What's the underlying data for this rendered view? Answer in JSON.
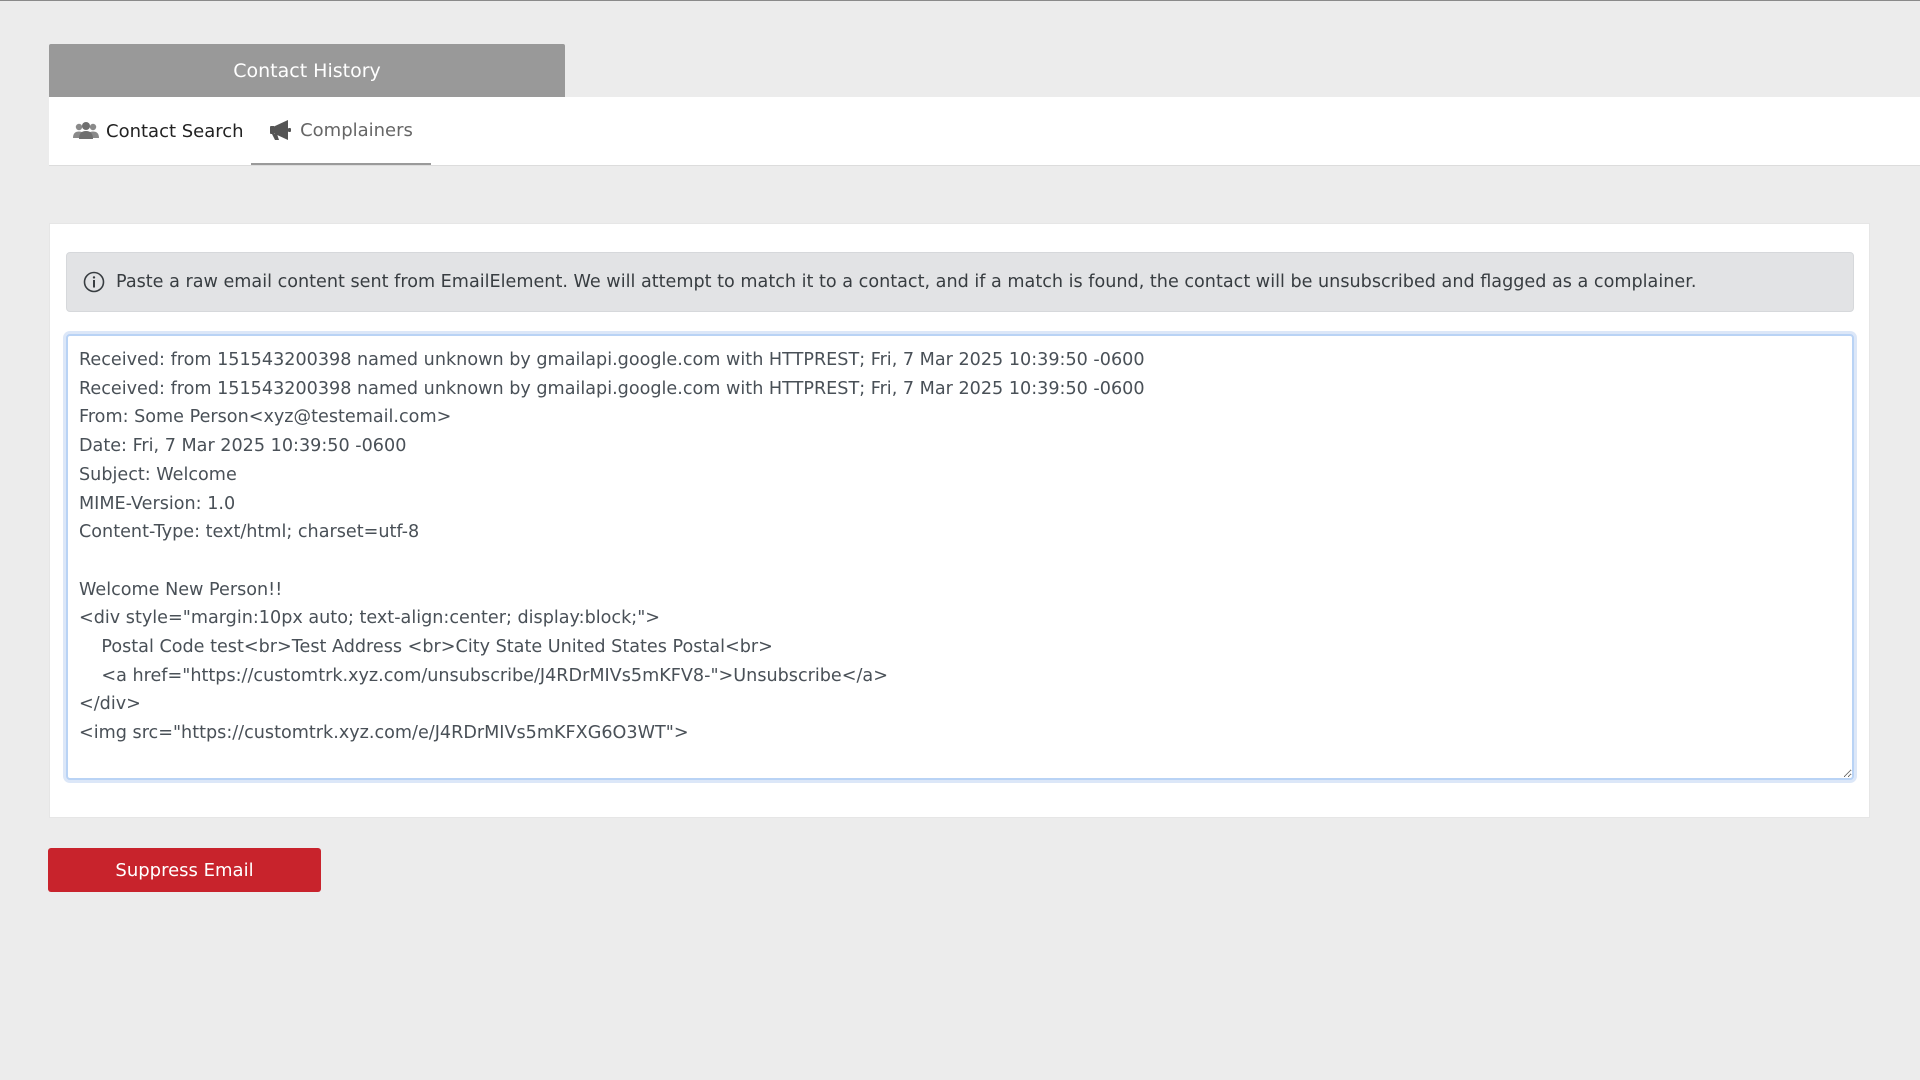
{
  "header": {
    "title": "Contact History"
  },
  "tabs": [
    {
      "label": "Contact Search",
      "icon": "users-icon",
      "active": false
    },
    {
      "label": "Complainers",
      "icon": "bullhorn-icon",
      "active": true
    }
  ],
  "alert": {
    "icon": "info-circle-icon",
    "text": "Paste a raw email content sent from EmailElement. We will attempt to match it to a contact, and if a match is found, the contact will be unsubscribed and flagged as a complainer."
  },
  "email_input": {
    "value": "Received: from 151543200398 named unknown by gmailapi.google.com with HTTPREST; Fri, 7 Mar 2025 10:39:50 -0600\nReceived: from 151543200398 named unknown by gmailapi.google.com with HTTPREST; Fri, 7 Mar 2025 10:39:50 -0600\nFrom: Some Person<xyz@testemail.com>\nDate: Fri, 7 Mar 2025 10:39:50 -0600\nSubject: Welcome\nMIME-Version: 1.0\nContent-Type: text/html; charset=utf-8\n\nWelcome New Person!!\n<div style=\"margin:10px auto; text-align:center; display:block;\">\n    Postal Code test<br>Test Address <br>City State United States Postal<br>\n    <a href=\"https://customtrk.xyz.com/unsubscribe/J4RDrMIVs5mKFV8-\">Unsubscribe</a>\n</div>\n<img src=\"https://customtrk.xyz.com/e/J4RDrMIVs5mKFXG6O3WT\">"
  },
  "actions": {
    "suppress_label": "Suppress Email"
  },
  "colors": {
    "header_bg": "#999999",
    "button_bg": "#c8232c",
    "alert_bg": "#e2e3e5",
    "page_bg": "#ececec"
  }
}
